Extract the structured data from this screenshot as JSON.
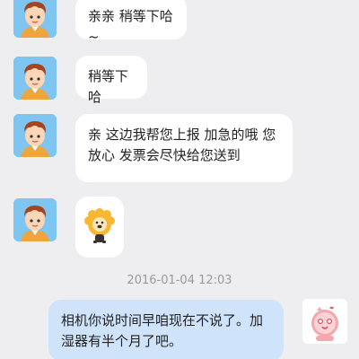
{
  "messages": [
    {
      "sender": "agent",
      "text": "亲亲 稍等下哈~"
    },
    {
      "sender": "agent",
      "text": "稍等下哈"
    },
    {
      "sender": "agent",
      "text": "亲 这边我帮您上报 加急的哦 您放心 发票会尽快给您送到"
    },
    {
      "sender": "agent",
      "sticker": "lion-sticker-icon"
    }
  ],
  "timestamp": "2016-01-04 12:03",
  "customer_message": {
    "sender": "customer",
    "text": "相机你说时间早咱现在不说了。加湿器有半个月了吧。"
  },
  "colors": {
    "background": "#eeeef0",
    "agent_bubble": "#ffffff",
    "customer_bubble": "#cfe4fb",
    "avatar_bg": "#7ec6f1"
  }
}
